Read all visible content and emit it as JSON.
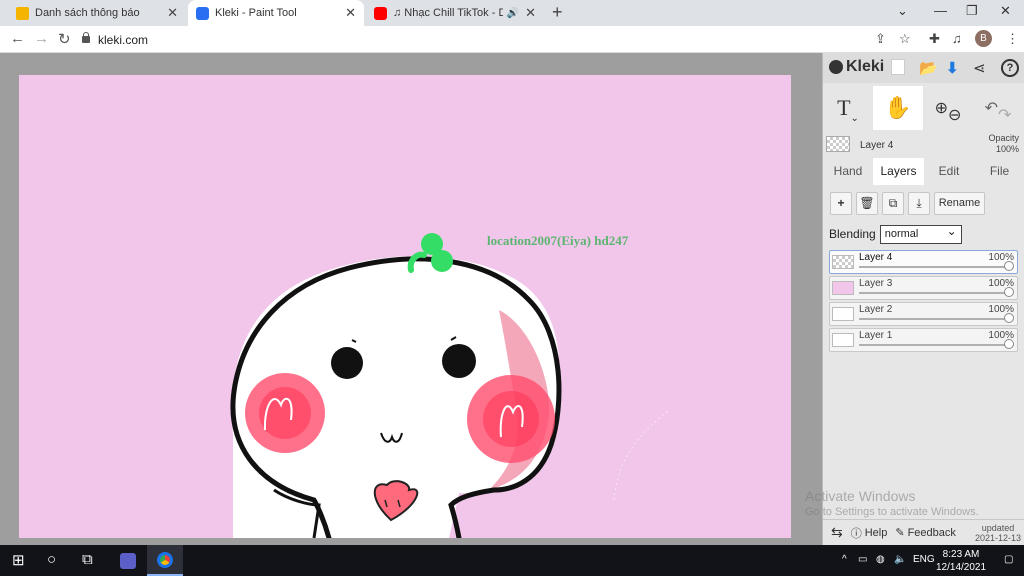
{
  "browser": {
    "tabs": [
      {
        "title": "Danh sách thông báo",
        "favicon": "huong-dan-favicon",
        "color": "#f4b400",
        "active": false
      },
      {
        "title": "Kleki - Paint Tool",
        "favicon": "kleki-favicon",
        "color": "#2a6ef2",
        "active": true
      },
      {
        "title": "♫ Nhạc Chill TikTok - Dịu Dà",
        "favicon": "youtube-favicon",
        "color": "#ff0000",
        "active": false
      }
    ],
    "new_tab": "+",
    "url": "kleki.com",
    "profile_initial": "B"
  },
  "canvas": {
    "background": "#f2c6ea",
    "watermark": "location2007(Eiya) hd247"
  },
  "app": {
    "logo": "Kleki",
    "mini_layer": {
      "name": "Layer 4",
      "opacity_label": "Opacity",
      "opacity": "100%"
    },
    "panel_tabs": [
      "Hand",
      "Layers",
      "Edit",
      "File"
    ],
    "active_tab": "Layers",
    "rename_label": "Rename",
    "blending_label": "Blending",
    "blending_value": "normal",
    "layers": [
      {
        "name": "Layer 4",
        "opacity": "100%",
        "active": true
      },
      {
        "name": "Layer 3",
        "opacity": "100%",
        "active": false
      },
      {
        "name": "Layer 2",
        "opacity": "100%",
        "active": false
      },
      {
        "name": "Layer 1",
        "opacity": "100%",
        "active": false
      }
    ],
    "footer": {
      "help": "Help",
      "feedback": "Feedback",
      "updated_label": "updated",
      "updated_date": "2021-12-13"
    }
  },
  "os": {
    "activate_title": "Activate Windows",
    "activate_sub": "Go to Settings to activate Windows.",
    "language": "ENG",
    "time": "8:23 AM",
    "date": "12/14/2021"
  }
}
